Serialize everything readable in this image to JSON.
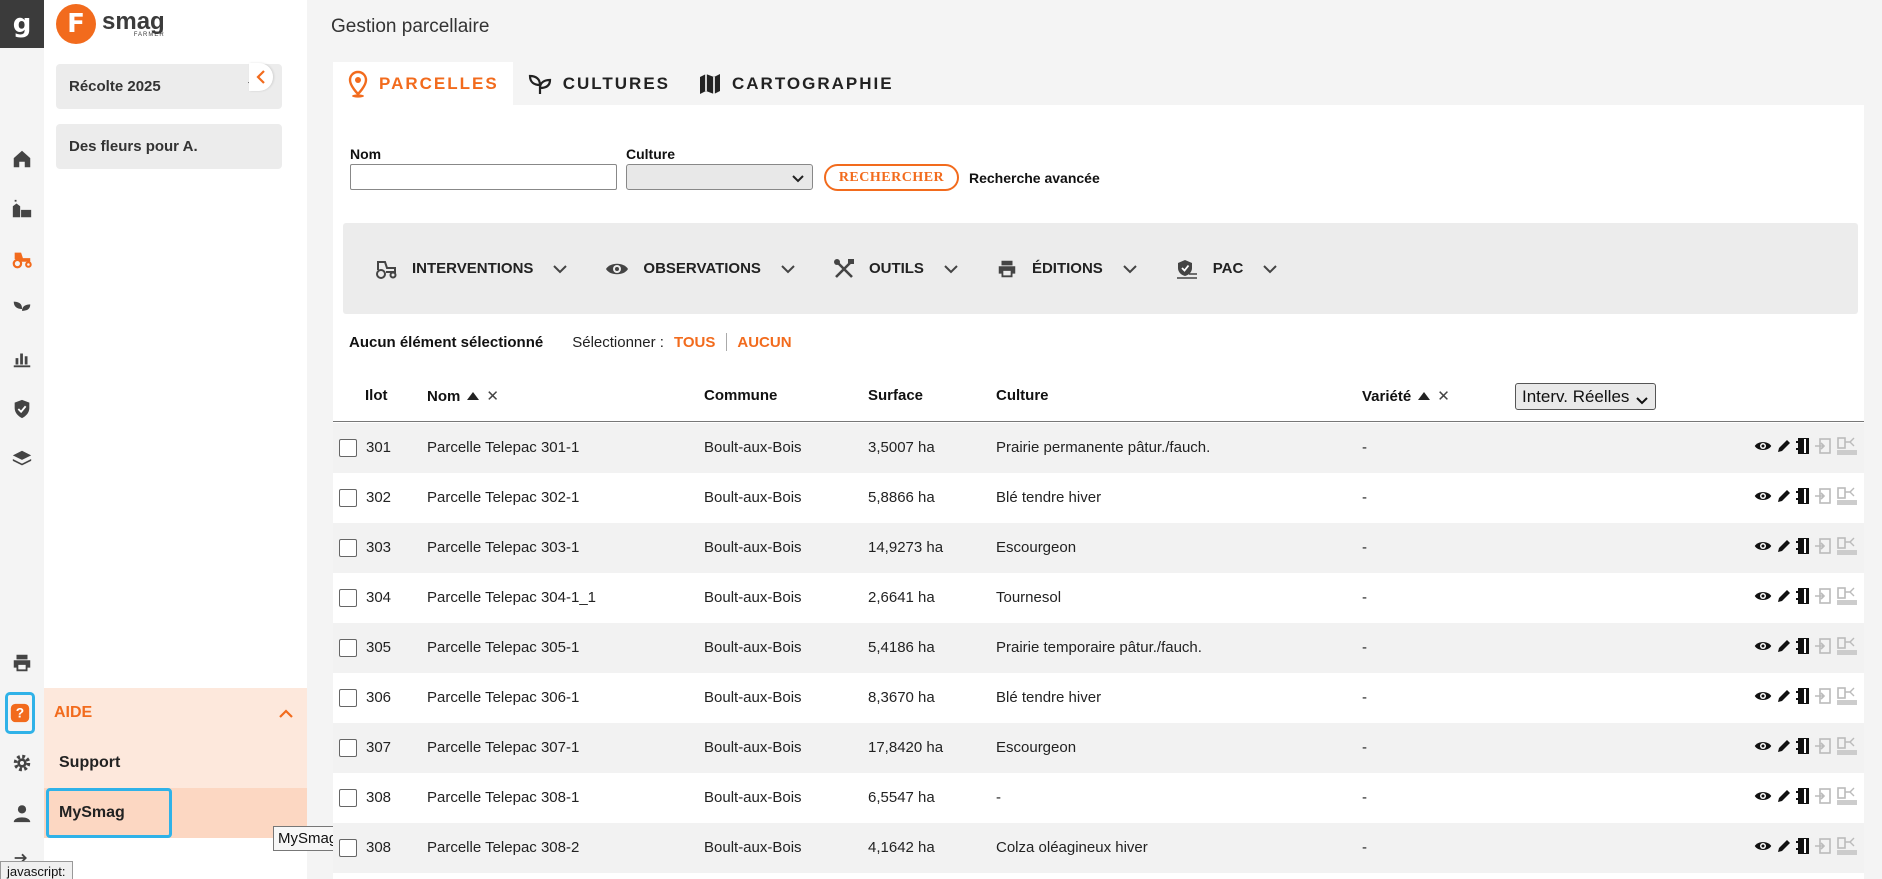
{
  "rail": {
    "logo": "g",
    "icons": [
      "home-icon",
      "farm-icon",
      "tractor-icon",
      "sprout-icon",
      "bar-chart-icon",
      "shield-check-icon",
      "layers-icon",
      "printer-icon",
      "help-icon",
      "gear-icon",
      "user-icon",
      "logout-icon"
    ]
  },
  "brand": {
    "mark": "F",
    "name": "smag",
    "sub": "FARMER"
  },
  "sidebar": {
    "season": "Récolte 2025",
    "farm": "Des fleurs pour A.",
    "aide": {
      "label": "AIDE",
      "items": [
        "Support",
        "MySmag"
      ]
    }
  },
  "tooltip": "MySmag",
  "status_bar": "javascript:",
  "page": {
    "title": "Gestion parcellaire"
  },
  "tabs": [
    {
      "label": "PARCELLES",
      "icon": "map-pin-icon",
      "active": true
    },
    {
      "label": "CULTURES",
      "icon": "plant-icon",
      "active": false
    },
    {
      "label": "CARTOGRAPHIE",
      "icon": "map-icon",
      "active": false
    }
  ],
  "search": {
    "name_label": "Nom",
    "name_value": "",
    "culture_label": "Culture",
    "culture_value": "",
    "search_button": "RECHERCHER",
    "advanced": "Recherche avancée"
  },
  "toolbar": [
    {
      "label": "INTERVENTIONS",
      "icon": "tractor-icon"
    },
    {
      "label": "OBSERVATIONS",
      "icon": "eye-icon"
    },
    {
      "label": "OUTILS",
      "icon": "tools-icon"
    },
    {
      "label": "ÉDITIONS",
      "icon": "printer-icon"
    },
    {
      "label": "PAC",
      "icon": "pac-icon"
    }
  ],
  "selection": {
    "status": "Aucun élément sélectionné",
    "select_label": "Sélectionner :",
    "all": "TOUS",
    "none": "AUCUN"
  },
  "table": {
    "columns": [
      "Ilot",
      "Nom",
      "Commune",
      "Surface",
      "Culture",
      "Variété"
    ],
    "interv_select": "Interv. Réelles",
    "rows": [
      {
        "ilot": "301",
        "nom": "Parcelle Telepac 301-1",
        "commune": "Boult-aux-Bois",
        "surface": "3,5007 ha",
        "culture": "Prairie permanente pâtur./fauch.",
        "variete": "-"
      },
      {
        "ilot": "302",
        "nom": "Parcelle Telepac 302-1",
        "commune": "Boult-aux-Bois",
        "surface": "5,8866 ha",
        "culture": "Blé tendre hiver",
        "variete": "-"
      },
      {
        "ilot": "303",
        "nom": "Parcelle Telepac 303-1",
        "commune": "Boult-aux-Bois",
        "surface": "14,9273 ha",
        "culture": "Escourgeon",
        "variete": "-"
      },
      {
        "ilot": "304",
        "nom": "Parcelle Telepac 304-1_1",
        "commune": "Boult-aux-Bois",
        "surface": "2,6641 ha",
        "culture": "Tournesol",
        "variete": "-"
      },
      {
        "ilot": "305",
        "nom": "Parcelle Telepac 305-1",
        "commune": "Boult-aux-Bois",
        "surface": "5,4186 ha",
        "culture": "Prairie temporaire pâtur./fauch.",
        "variete": "-"
      },
      {
        "ilot": "306",
        "nom": "Parcelle Telepac 306-1",
        "commune": "Boult-aux-Bois",
        "surface": "8,3670 ha",
        "culture": "Blé tendre hiver",
        "variete": "-"
      },
      {
        "ilot": "307",
        "nom": "Parcelle Telepac 307-1",
        "commune": "Boult-aux-Bois",
        "surface": "17,8420 ha",
        "culture": "Escourgeon",
        "variete": "-"
      },
      {
        "ilot": "308",
        "nom": "Parcelle Telepac 308-1",
        "commune": "Boult-aux-Bois",
        "surface": "6,5547 ha",
        "culture": "-",
        "variete": "-"
      },
      {
        "ilot": "308",
        "nom": "Parcelle Telepac 308-2",
        "commune": "Boult-aux-Bois",
        "surface": "4,1642 ha",
        "culture": "Colza oléagineux hiver",
        "variete": "-"
      }
    ]
  },
  "colors": {
    "accent": "#f26b1d",
    "highlight": "#2fb2e8",
    "aide_bg": "#fde8dc"
  }
}
